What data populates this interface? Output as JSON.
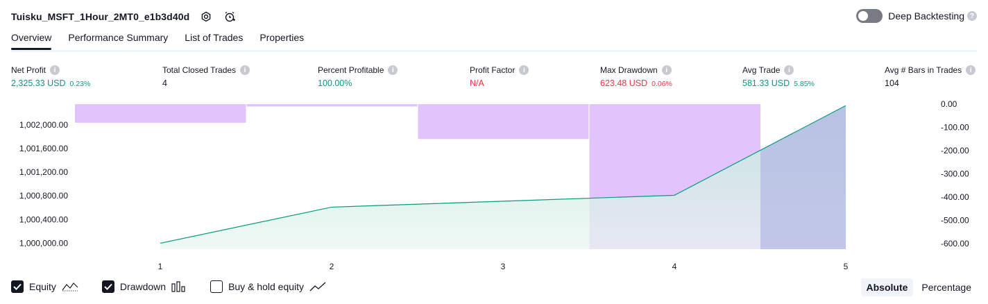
{
  "header": {
    "title": "Tuisku_MSFT_1Hour_2MT0_e1b3d40d",
    "deep_backtesting_label": "Deep Backtesting"
  },
  "tabs": [
    {
      "label": "Overview"
    },
    {
      "label": "Performance Summary"
    },
    {
      "label": "List of Trades"
    },
    {
      "label": "Properties"
    }
  ],
  "metrics": {
    "net_profit": {
      "label": "Net Profit",
      "value": "2,325.33 USD",
      "sub": "0.23%"
    },
    "total_closed_trades": {
      "label": "Total Closed Trades",
      "value": "4"
    },
    "percent_profitable": {
      "label": "Percent Profitable",
      "value": "100.00%"
    },
    "profit_factor": {
      "label": "Profit Factor",
      "value": "N/A"
    },
    "max_drawdown": {
      "label": "Max Drawdown",
      "value": "623.48 USD",
      "sub": "0.06%"
    },
    "avg_trade": {
      "label": "Avg Trade",
      "value": "581.33 USD",
      "sub": "5.85%"
    },
    "avg_bars": {
      "label": "Avg # Bars in Trades",
      "value": "104"
    }
  },
  "legend": {
    "equity_label": "Equity",
    "drawdown_label": "Drawdown",
    "buyhold_label": "Buy & hold equity",
    "equity_checked": true,
    "drawdown_checked": true,
    "buyhold_checked": false
  },
  "mode": {
    "absolute_label": "Absolute",
    "percentage_label": "Percentage"
  },
  "colors": {
    "positive": "#089981",
    "negative": "#f23645",
    "drawdown_fill": "#e1c4fb",
    "overlap_fill": "#b1b6e3",
    "equity_area": "#e3f4ef"
  },
  "chart_data": {
    "type": "area",
    "x": [
      1,
      2,
      3,
      4,
      5
    ],
    "x_ticks": [
      "1",
      "2",
      "3",
      "4",
      "5"
    ],
    "series": [
      {
        "name": "Equity",
        "values": [
          1000000,
          1000610,
          1000710,
          1000810,
          1002325.33
        ]
      },
      {
        "name": "Drawdown",
        "values": [
          -80,
          -10,
          -150,
          -623.48
        ]
      }
    ],
    "left_axis": {
      "ylim": [
        999900,
        1002350
      ],
      "ticks": [
        1000000,
        1000400,
        1000800,
        1001200,
        1001600,
        1002000
      ],
      "tick_labels": [
        "1,000,000.00",
        "1,000,400.00",
        "1,000,800.00",
        "1,001,200.00",
        "1,001,600.00",
        "1,002,000.00"
      ]
    },
    "right_axis": {
      "ylim": [
        -623.48,
        0
      ],
      "ticks": [
        0,
        -100,
        -200,
        -300,
        -400,
        -500,
        -600
      ],
      "tick_labels": [
        "0.00",
        "-100.00",
        "-200.00",
        "-300.00",
        "-400.00",
        "-500.00",
        "-600.00"
      ]
    },
    "grid": false
  }
}
